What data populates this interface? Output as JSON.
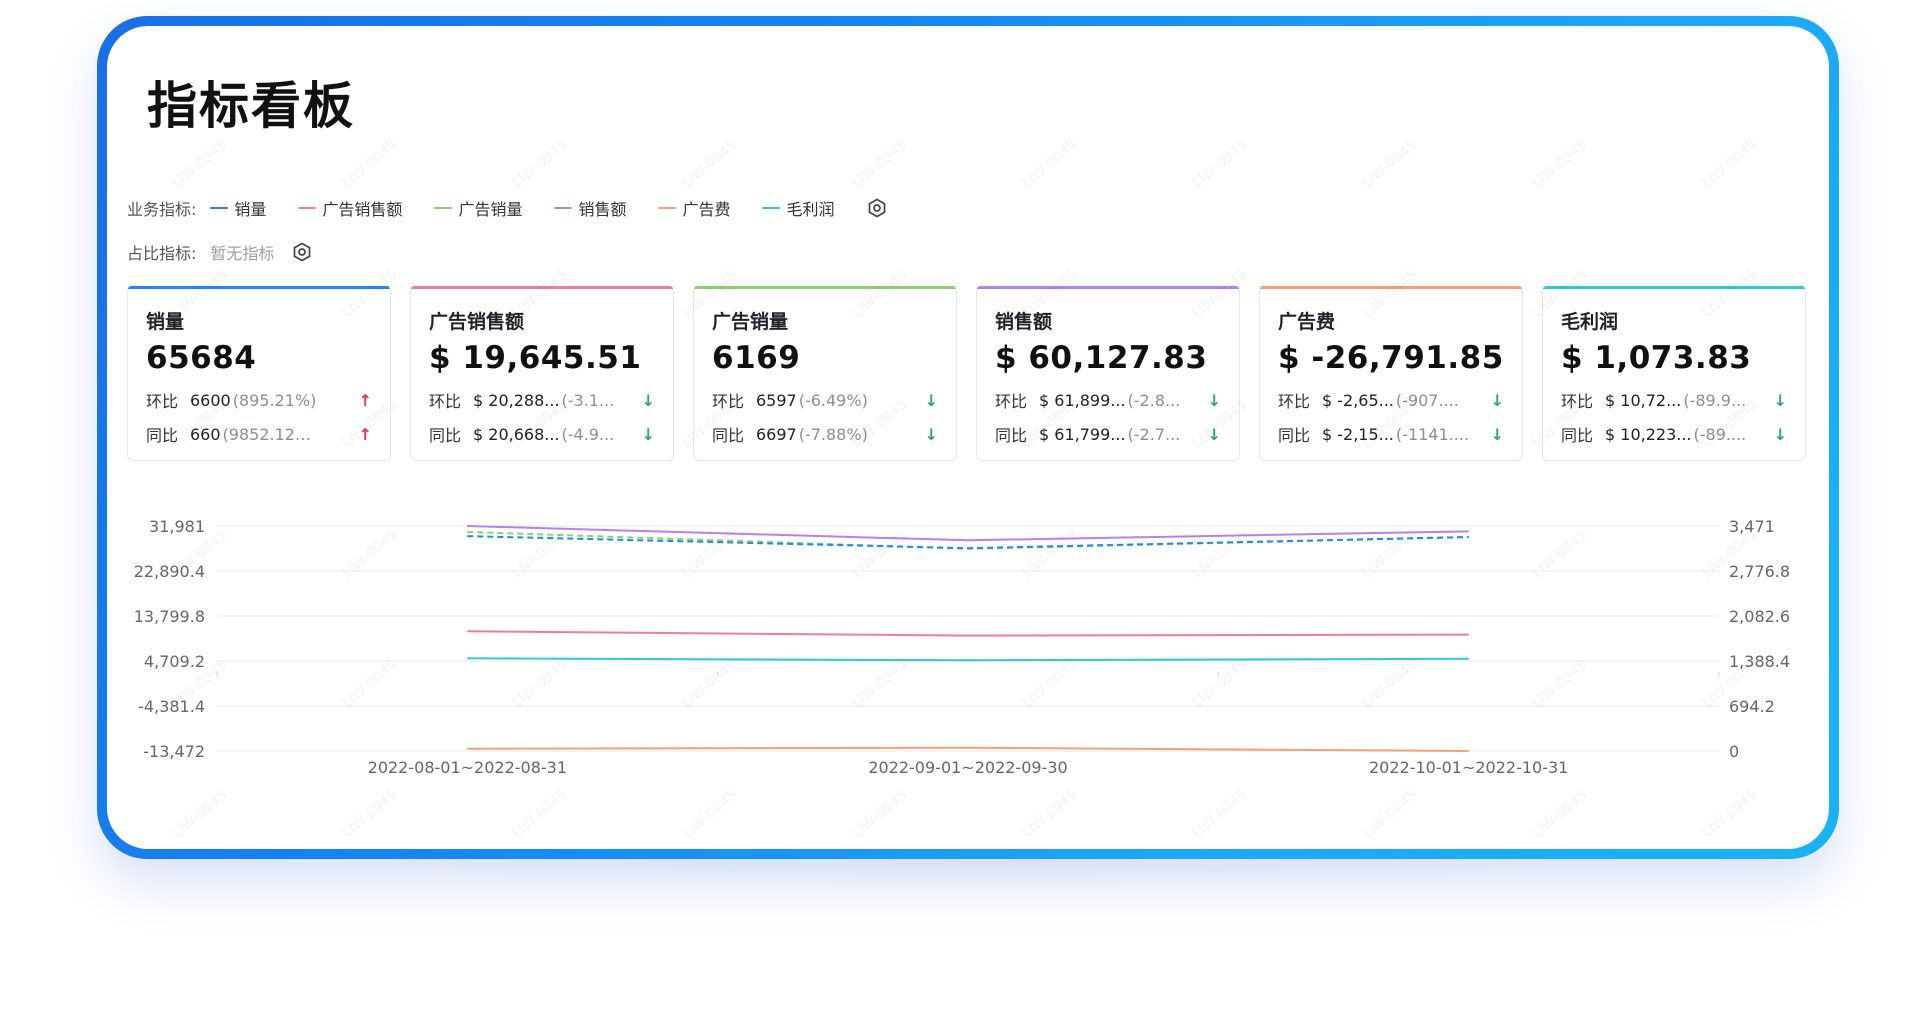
{
  "page": {
    "title": "指标看板"
  },
  "legend": {
    "biz_label": "业务指标:",
    "items": [
      {
        "label": "销量",
        "color": "#1a8cf0"
      },
      {
        "label": "广告销售额",
        "color": "#f27b9a"
      },
      {
        "label": "广告销量",
        "color": "#8bd06a"
      },
      {
        "label": "销售额",
        "color": "#b97ef0"
      },
      {
        "label": "广告费",
        "color": "#f5a06e"
      },
      {
        "label": "毛利润",
        "color": "#2ec9d6"
      }
    ],
    "ratio_label": "占比指标:",
    "ratio_empty": "暂无指标",
    "settings_icon": "gear-icon"
  },
  "cards": [
    {
      "name": "销量",
      "value": "65684",
      "color": "#1a8cf0",
      "dashed": true,
      "mom_label": "环比",
      "mom_value": "6600",
      "mom_pct": "(895.21%)",
      "mom_dir": "up",
      "yoy_label": "同比",
      "yoy_value": "660",
      "yoy_pct": "(9852.12%)",
      "yoy_dir": "up"
    },
    {
      "name": "广告销售额",
      "value": "$ 19,645.51",
      "color": "#f27b9a",
      "dashed": false,
      "mom_label": "环比",
      "mom_value": "$ 20,288...",
      "mom_pct": "(-3.1...",
      "mom_dir": "down",
      "yoy_label": "同比",
      "yoy_value": "$ 20,668...",
      "yoy_pct": "(-4.9...",
      "yoy_dir": "down"
    },
    {
      "name": "广告销量",
      "value": "6169",
      "color": "#8bd06a",
      "dashed": true,
      "mom_label": "环比",
      "mom_value": "6597",
      "mom_pct": "(-6.49%)",
      "mom_dir": "down",
      "yoy_label": "同比",
      "yoy_value": "6697",
      "yoy_pct": "(-7.88%)",
      "yoy_dir": "down"
    },
    {
      "name": "销售额",
      "value": "$ 60,127.83",
      "color": "#b97ef0",
      "dashed": false,
      "mom_label": "环比",
      "mom_value": "$ 61,899...",
      "mom_pct": "(-2.8...",
      "mom_dir": "down",
      "yoy_label": "同比",
      "yoy_value": "$ 61,799...",
      "yoy_pct": "(-2.7...",
      "yoy_dir": "down"
    },
    {
      "name": "广告费",
      "value": "$ -26,791.85",
      "color": "#f5a06e",
      "dashed": false,
      "mom_label": "环比",
      "mom_value": "$ -2,65...",
      "mom_pct": "(-907....",
      "mom_dir": "down",
      "yoy_label": "同比",
      "yoy_value": "$ -2,15...",
      "yoy_pct": "(-1141....",
      "yoy_dir": "down"
    },
    {
      "name": "毛利润",
      "value": "$ 1,073.83",
      "color": "#2ec9d6",
      "dashed": false,
      "mom_label": "环比",
      "mom_value": "$ 10,72...",
      "mom_pct": "(-89.9...",
      "mom_dir": "down",
      "yoy_label": "同比",
      "yoy_value": "$ 10,223...",
      "yoy_pct": "(-89....",
      "yoy_dir": "down"
    }
  ],
  "chart_data": {
    "type": "line",
    "x": [
      "2022-08-01~2022-08-31",
      "2022-09-01~2022-09-30",
      "2022-10-01~2022-10-31"
    ],
    "y_left_ticks": [
      "31,981",
      "22,890.4",
      "13,799.8",
      "4,709.2",
      "-4,381.4",
      "-13,472"
    ],
    "y_right_ticks": [
      "3,471",
      "2,776.8",
      "2,082.6",
      "1,388.4",
      "694.2",
      "0"
    ],
    "y_left_range": [
      -13472,
      31981
    ],
    "y_right_range": [
      0,
      3471
    ],
    "grid": true,
    "series": [
      {
        "name": "销售额",
        "axis": "left",
        "color": "#b97ef0",
        "dashed": false,
        "values": [
          31981,
          29100,
          30900
        ]
      },
      {
        "name": "广告销量",
        "axis": "right",
        "color": "#8bd06a",
        "dashed": true,
        "values": [
          3380,
          3120,
          3300
        ]
      },
      {
        "name": "销量",
        "axis": "left",
        "color": "#1a8cf0",
        "dashed": true,
        "values": [
          29950,
          27500,
          29750
        ]
      },
      {
        "name": "广告销售额",
        "axis": "left",
        "color": "#f27b9a",
        "dashed": false,
        "values": [
          10700,
          9850,
          10050
        ]
      },
      {
        "name": "毛利润",
        "axis": "left",
        "color": "#2ec9d6",
        "dashed": false,
        "values": [
          5250,
          4850,
          5150
        ]
      },
      {
        "name": "广告费",
        "axis": "left",
        "color": "#f5a06e",
        "dashed": false,
        "values": [
          -13000,
          -12800,
          -13472
        ]
      }
    ]
  }
}
